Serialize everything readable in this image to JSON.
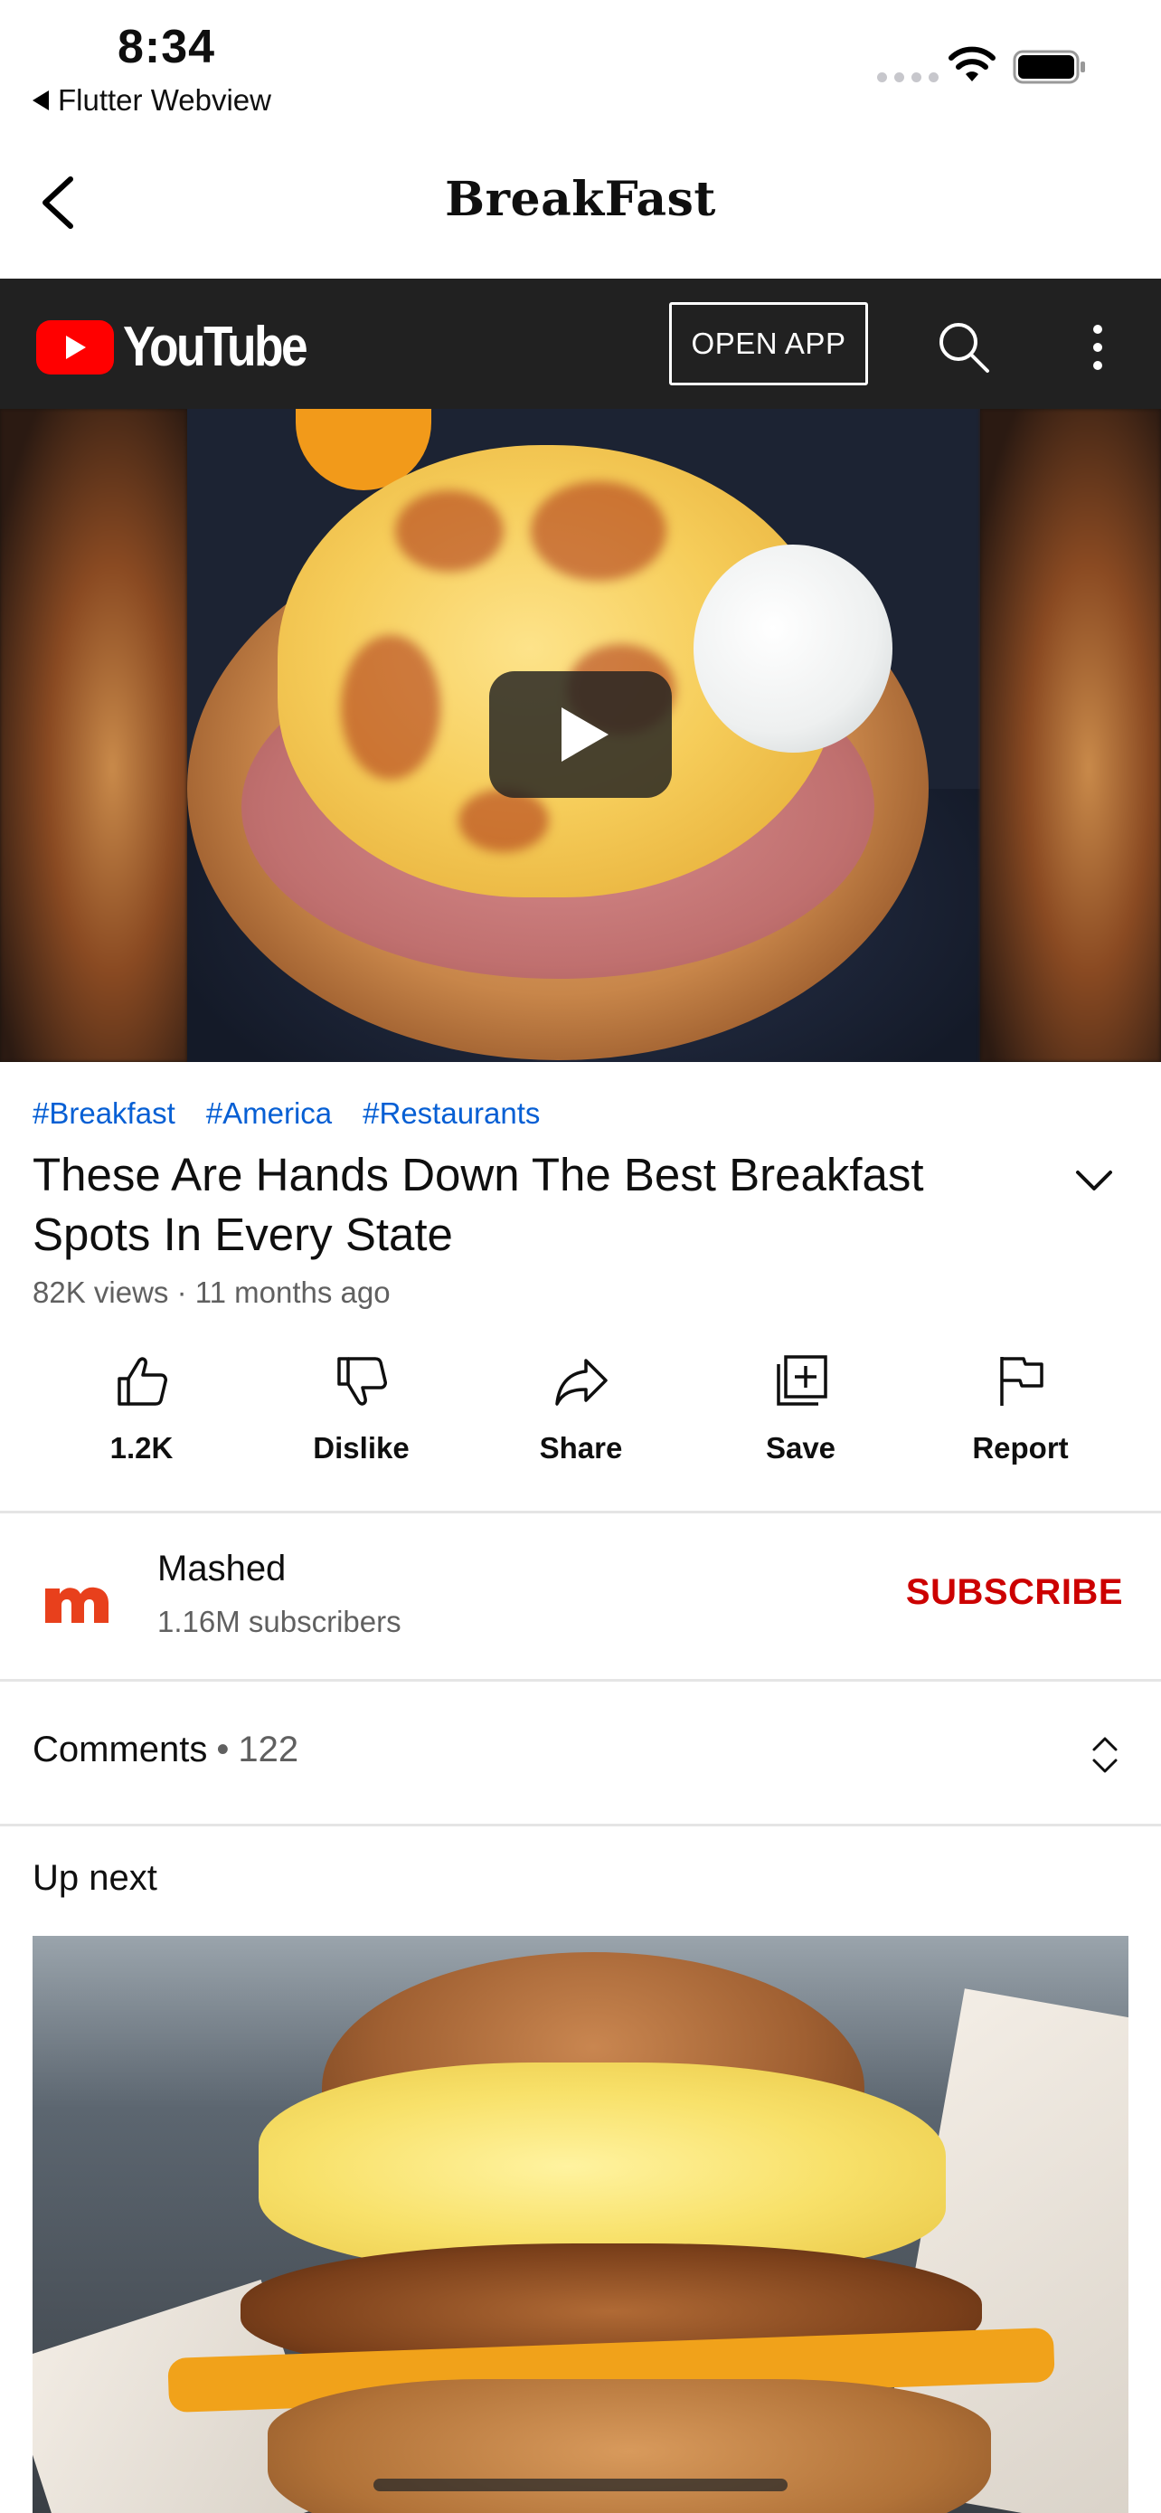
{
  "status_bar": {
    "time": "8:34",
    "back_app": "Flutter Webview"
  },
  "app_bar": {
    "title": "BreakFast"
  },
  "youtube_header": {
    "logo_text": "YouTube",
    "open_app_label": "OPEN APP"
  },
  "video": {
    "tags": [
      "#Breakfast",
      "#America",
      "#Restaurants"
    ],
    "title": "These Are Hands Down The Best Breakfast Spots In Every State",
    "meta": "82K views · 11 months ago"
  },
  "actions": [
    {
      "label": "1.2K",
      "icon": "thumbs-up-icon"
    },
    {
      "label": "Dislike",
      "icon": "thumbs-down-icon"
    },
    {
      "label": "Share",
      "icon": "share-icon"
    },
    {
      "label": "Save",
      "icon": "save-to-playlist-icon"
    },
    {
      "label": "Report",
      "icon": "flag-icon"
    }
  ],
  "channel": {
    "name": "Mashed",
    "subscribers": "1.16M subscribers",
    "subscribe_label": "SUBSCRIBE",
    "avatar_letter": "m"
  },
  "comments": {
    "label": "Comments",
    "separator": "•",
    "count": "122"
  },
  "up_next": {
    "label": "Up next"
  },
  "colors": {
    "youtube_red": "#ff0000",
    "subscribe_red": "#cc0000",
    "tag_blue": "#065fd4",
    "header_dark": "#212121",
    "mashed_orange": "#e8401c"
  }
}
